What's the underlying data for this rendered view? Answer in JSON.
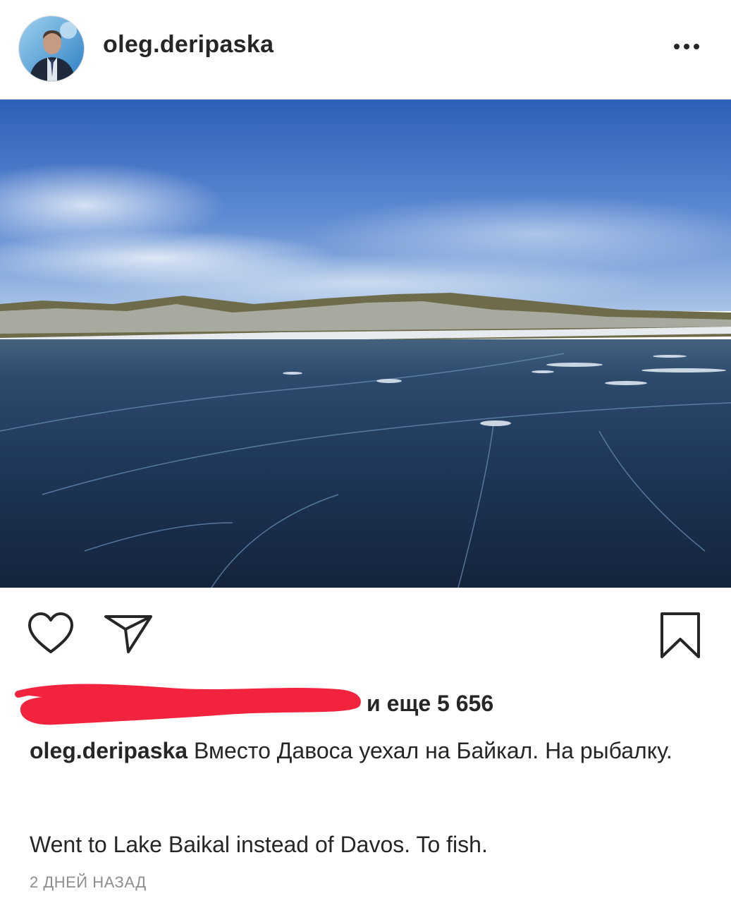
{
  "post": {
    "username": "oleg.deripaska",
    "avatar_icon": "profile-photo",
    "more_icon": "more-horizontal-icon",
    "photo_alt": "frozen lake",
    "actions": {
      "like_icon": "heart-outline-icon",
      "share_icon": "send-paper-plane-icon",
      "save_icon": "bookmark-outline-icon"
    },
    "likes": {
      "redacted_names_icon": "red-scribble-redaction",
      "others_text": "и еще 5 656"
    },
    "caption": {
      "author": "oleg.deripaska",
      "text_ru": "Вместо Давоса уехал на Байкал. На рыбалку.",
      "text_en": "Went to Lake Baikal instead of Davos. To fish."
    },
    "timestamp": "2 ДНЕЙ НАЗАД"
  },
  "colors": {
    "text": "#262626",
    "muted": "#8e8e8e",
    "redaction": "#f2233c",
    "sky": "#3f6fc4",
    "ice": "#1d3454"
  }
}
